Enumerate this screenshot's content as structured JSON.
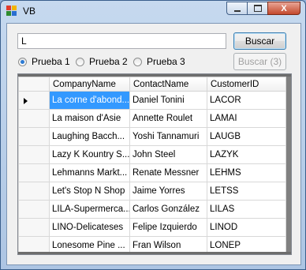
{
  "window": {
    "title": "VB",
    "close_label": "X"
  },
  "search": {
    "value": "L",
    "button_label": "Buscar",
    "button2_label": "Buscar (3)"
  },
  "radios": [
    {
      "label": "Prueba 1",
      "checked": true
    },
    {
      "label": "Prueba 2",
      "checked": false
    },
    {
      "label": "Prueba 3",
      "checked": false
    }
  ],
  "grid": {
    "columns": [
      "CompanyName",
      "ContactName",
      "CustomerID"
    ],
    "rows": [
      [
        "La corne d'abond...",
        "Daniel Tonini",
        "LACOR"
      ],
      [
        "La maison d'Asie",
        "Annette Roulet",
        "LAMAI"
      ],
      [
        "Laughing Bacch...",
        "Yoshi Tannamuri",
        "LAUGB"
      ],
      [
        "Lazy K Kountry S...",
        "John Steel",
        "LAZYK"
      ],
      [
        "Lehmanns Markt...",
        "Renate Messner",
        "LEHMS"
      ],
      [
        "Let's Stop N Shop",
        "Jaime Yorres",
        "LETSS"
      ],
      [
        "LILA-Supermerca...",
        "Carlos González",
        "LILAS"
      ],
      [
        "LINO-Delicateses",
        "Felipe Izquierdo",
        "LINOD"
      ],
      [
        "Lonesome Pine ...",
        "Fran Wilson",
        "LONEP"
      ]
    ]
  }
}
